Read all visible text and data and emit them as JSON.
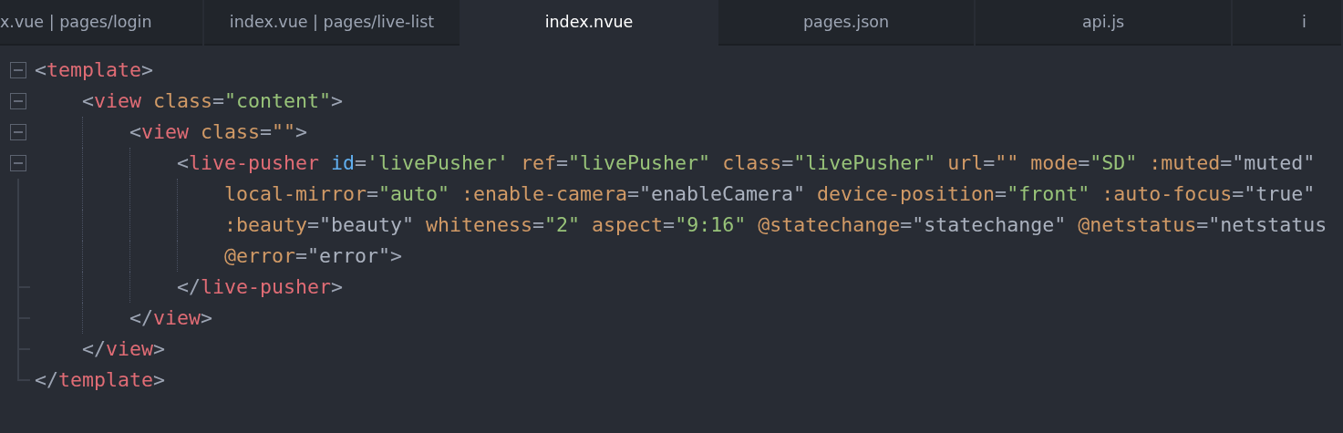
{
  "tabs": [
    {
      "label": "x.vue | pages/login",
      "selected": false
    },
    {
      "label": "index.vue | pages/live-list",
      "selected": false
    },
    {
      "label": "index.nvue",
      "selected": true
    },
    {
      "label": "pages.json",
      "selected": false
    },
    {
      "label": "api.js",
      "selected": false
    },
    {
      "label": "i",
      "selected": false
    }
  ],
  "code": [
    {
      "expanded": true,
      "lines": [
        [
          {
            "kind": "punct",
            "text": "<"
          },
          {
            "kind": "tag",
            "text": "template"
          },
          {
            "kind": "punct",
            "text": ">"
          }
        ]
      ],
      "children": [
        {
          "expanded": true,
          "lines": [
            [
              {
                "kind": "punct",
                "text": "<"
              },
              {
                "kind": "tag",
                "text": "view"
              },
              {
                "kind": "attr",
                "text": " class"
              },
              {
                "kind": "punct",
                "text": "="
              },
              {
                "kind": "string",
                "text": "\"content\""
              },
              {
                "kind": "punct",
                "text": ">"
              }
            ]
          ],
          "children": [
            {
              "expanded": true,
              "lines": [
                [
                  {
                    "kind": "punct",
                    "text": "<"
                  },
                  {
                    "kind": "tag",
                    "text": "view"
                  },
                  {
                    "kind": "attr",
                    "text": " class"
                  },
                  {
                    "kind": "punct",
                    "text": "="
                  },
                  {
                    "kind": "attr",
                    "text": "\"\""
                  },
                  {
                    "kind": "punct",
                    "text": ">"
                  }
                ]
              ],
              "children": [
                {
                  "expanded": true,
                  "lines": [
                    [
                      {
                        "kind": "punct",
                        "text": "<"
                      },
                      {
                        "kind": "tag",
                        "text": "live-pusher"
                      },
                      {
                        "kind": "id",
                        "text": " id"
                      },
                      {
                        "kind": "punct",
                        "text": "="
                      },
                      {
                        "kind": "string",
                        "text": "'livePusher'"
                      },
                      {
                        "kind": "attr",
                        "text": " ref"
                      },
                      {
                        "kind": "punct",
                        "text": "="
                      },
                      {
                        "kind": "string",
                        "text": "\"livePusher\""
                      },
                      {
                        "kind": "attr",
                        "text": " class"
                      },
                      {
                        "kind": "punct",
                        "text": "="
                      },
                      {
                        "kind": "string",
                        "text": "\"livePusher\""
                      },
                      {
                        "kind": "attr",
                        "text": " url"
                      },
                      {
                        "kind": "punct",
                        "text": "="
                      },
                      {
                        "kind": "attr",
                        "text": "\"\""
                      },
                      {
                        "kind": "attr",
                        "text": " mode"
                      },
                      {
                        "kind": "punct",
                        "text": "="
                      },
                      {
                        "kind": "string",
                        "text": "\"SD\""
                      },
                      {
                        "kind": "attr",
                        "text": " :muted"
                      },
                      {
                        "kind": "punct",
                        "text": "="
                      },
                      {
                        "kind": "expr",
                        "text": "\"muted\""
                      }
                    ],
                    [
                      {
                        "kind": "attr",
                        "text": "local-mirror"
                      },
                      {
                        "kind": "punct",
                        "text": "="
                      },
                      {
                        "kind": "string",
                        "text": "\"auto\""
                      },
                      {
                        "kind": "attr",
                        "text": " :enable-camera"
                      },
                      {
                        "kind": "punct",
                        "text": "="
                      },
                      {
                        "kind": "expr",
                        "text": "\"enableCamera\""
                      },
                      {
                        "kind": "attr",
                        "text": " device-position"
                      },
                      {
                        "kind": "punct",
                        "text": "="
                      },
                      {
                        "kind": "string",
                        "text": "\"front\""
                      },
                      {
                        "kind": "attr",
                        "text": " :auto-focus"
                      },
                      {
                        "kind": "punct",
                        "text": "="
                      },
                      {
                        "kind": "expr",
                        "text": "\"true\""
                      }
                    ],
                    [
                      {
                        "kind": "attr",
                        "text": ":beauty"
                      },
                      {
                        "kind": "punct",
                        "text": "="
                      },
                      {
                        "kind": "expr",
                        "text": "\"beauty\""
                      },
                      {
                        "kind": "attr",
                        "text": " whiteness"
                      },
                      {
                        "kind": "punct",
                        "text": "="
                      },
                      {
                        "kind": "string",
                        "text": "\"2\""
                      },
                      {
                        "kind": "attr",
                        "text": " aspect"
                      },
                      {
                        "kind": "punct",
                        "text": "="
                      },
                      {
                        "kind": "string",
                        "text": "\"9:16\""
                      },
                      {
                        "kind": "attr",
                        "text": " @statechange"
                      },
                      {
                        "kind": "punct",
                        "text": "="
                      },
                      {
                        "kind": "expr",
                        "text": "\"statechange\""
                      },
                      {
                        "kind": "attr",
                        "text": " @netstatus"
                      },
                      {
                        "kind": "punct",
                        "text": "="
                      },
                      {
                        "kind": "expr",
                        "text": "\"netstatus"
                      }
                    ],
                    [
                      {
                        "kind": "attr",
                        "text": "@error"
                      },
                      {
                        "kind": "punct",
                        "text": "="
                      },
                      {
                        "kind": "expr",
                        "text": "\"error\""
                      },
                      {
                        "kind": "punct",
                        "text": ">"
                      }
                    ]
                  ],
                  "close": [
                    {
                      "kind": "punct",
                      "text": "</"
                    },
                    {
                      "kind": "tag",
                      "text": "live-pusher"
                    },
                    {
                      "kind": "punct",
                      "text": ">"
                    }
                  ]
                }
              ],
              "close": [
                {
                  "kind": "punct",
                  "text": "</"
                },
                {
                  "kind": "tag",
                  "text": "view"
                },
                {
                  "kind": "punct",
                  "text": ">"
                }
              ]
            }
          ],
          "close": [
            {
              "kind": "punct",
              "text": "</"
            },
            {
              "kind": "tag",
              "text": "view"
            },
            {
              "kind": "punct",
              "text": ">"
            }
          ]
        }
      ],
      "close": [
        {
          "kind": "punct",
          "text": "</"
        },
        {
          "kind": "tag",
          "text": "template"
        },
        {
          "kind": "punct",
          "text": ">"
        }
      ]
    }
  ]
}
